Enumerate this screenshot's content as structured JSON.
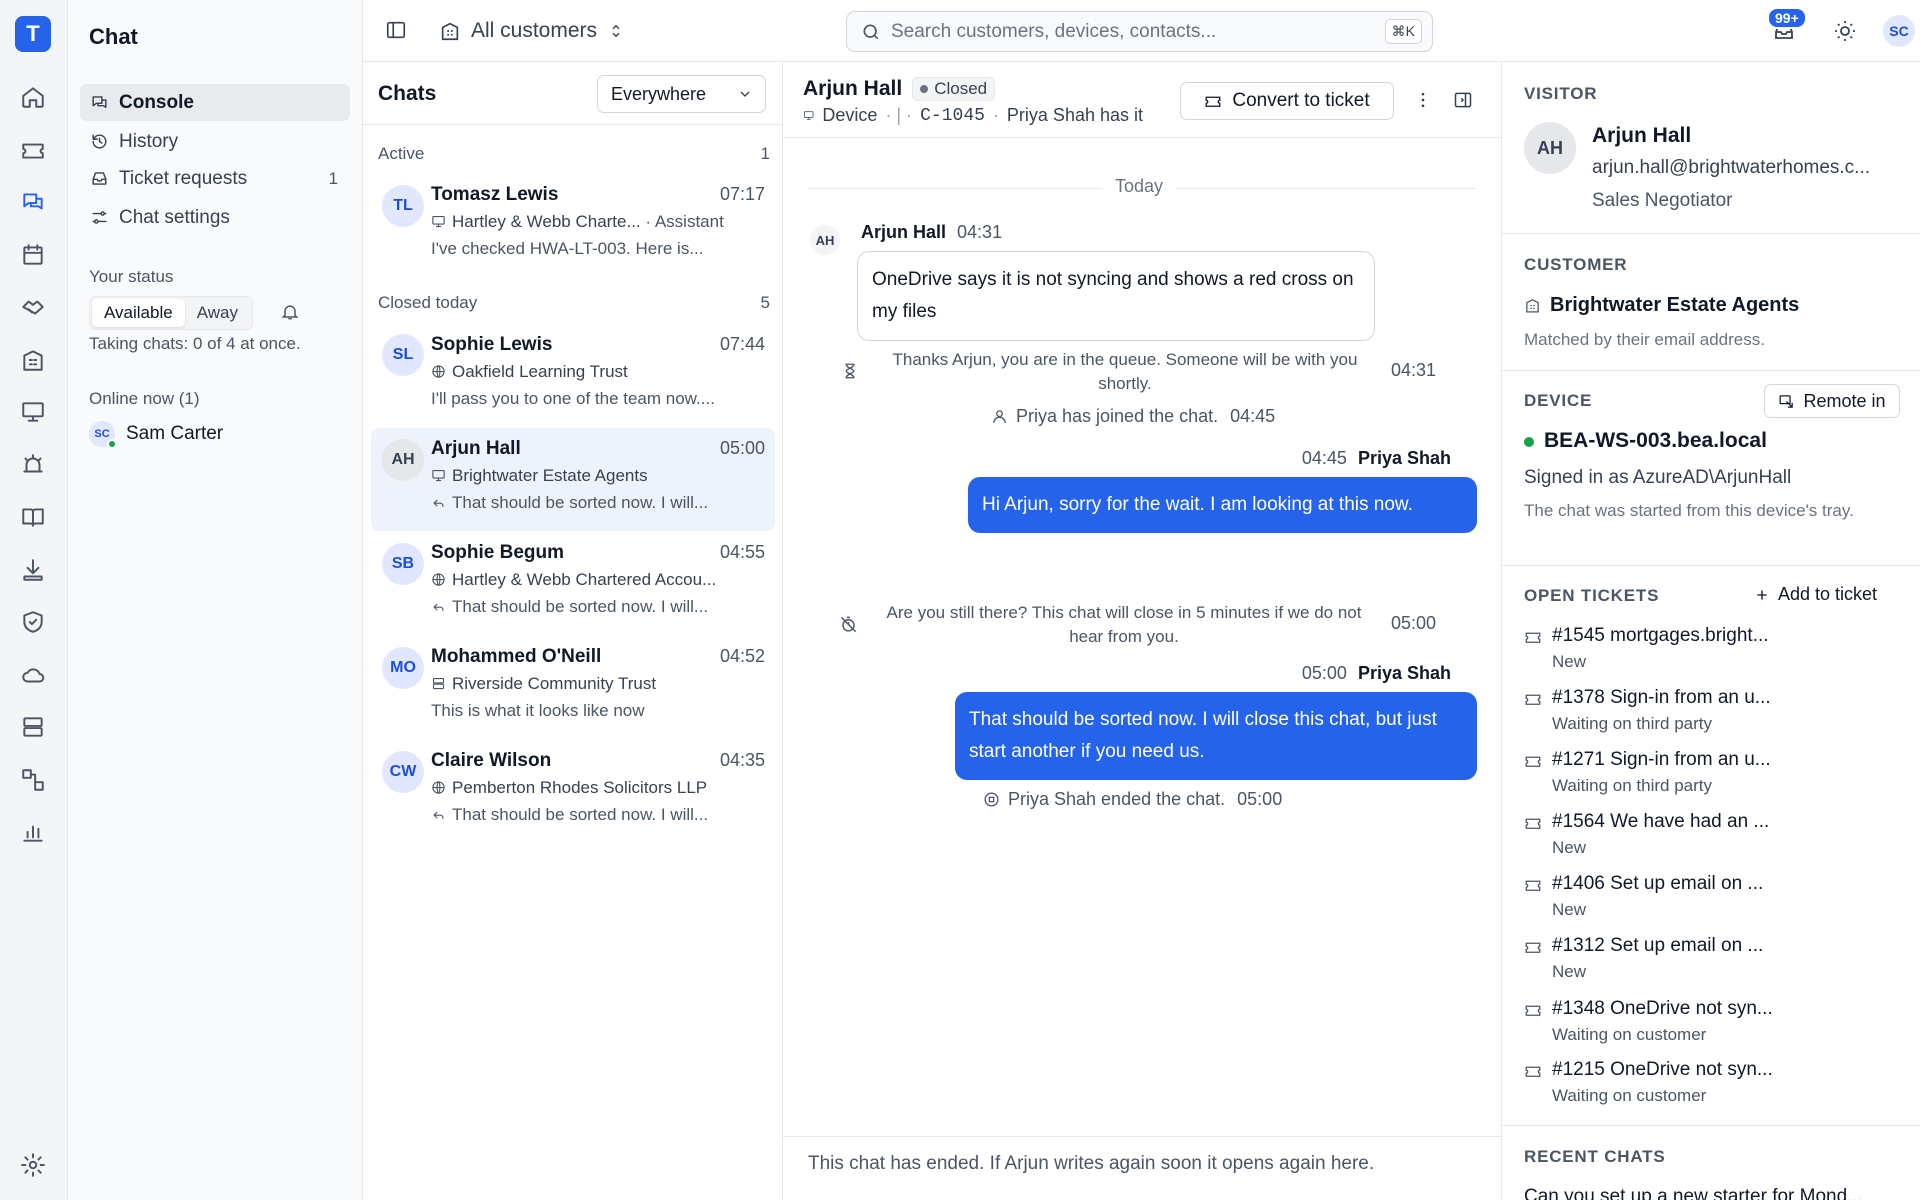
{
  "app": {
    "logo_letter": "T",
    "section_title": "Chat"
  },
  "rail": [
    "home-icon",
    "ticket-icon",
    "chat-icon",
    "calendar-icon",
    "handshake-icon",
    "building-icon",
    "monitor-icon",
    "alarm-icon",
    "book-icon",
    "download-icon",
    "shield-icon",
    "cloud-icon",
    "server-icon",
    "workflow-icon",
    "chart-icon"
  ],
  "nav": {
    "items": [
      {
        "label": "Console",
        "count": ""
      },
      {
        "label": "History",
        "count": ""
      },
      {
        "label": "Ticket requests",
        "count": "1"
      },
      {
        "label": "Chat settings",
        "count": ""
      }
    ],
    "your_status": "Your status",
    "status_available": "Available",
    "status_away": "Away",
    "taking": "Taking chats: 0 of 4 at once.",
    "online_now": "Online now (1)",
    "online_user_initials": "SC",
    "online_user_name": "Sam Carter"
  },
  "header": {
    "scope": "All customers",
    "search_placeholder": "Search customers, devices, contacts...",
    "shortcut": "⌘K",
    "notif_count": "99+",
    "user_initials": "SC"
  },
  "chats": {
    "title": "Chats",
    "filter": "Everywhere",
    "active_label": "Active",
    "active_count": "1",
    "closed_label": "Closed today",
    "closed_count": "5",
    "items": [
      {
        "initials": "TL",
        "name": "Tomasz Lewis",
        "time": "07:17",
        "sub": "Hartley & Webb Charte...",
        "sub2": "· Assistant",
        "msg": "I've checked HWA-LT-003. Here is..."
      },
      {
        "initials": "SL",
        "name": "Sophie Lewis",
        "time": "07:44",
        "sub": "Oakfield Learning Trust",
        "sub2": "",
        "msg": "I'll pass you to one of the team now...."
      },
      {
        "initials": "AH",
        "name": "Arjun Hall",
        "time": "05:00",
        "sub": "Brightwater Estate Agents",
        "sub2": "",
        "msg": "That should be sorted now. I will..."
      },
      {
        "initials": "SB",
        "name": "Sophie Begum",
        "time": "04:55",
        "sub": "Hartley & Webb Chartered Accou...",
        "sub2": "",
        "msg": "That should be sorted now. I will..."
      },
      {
        "initials": "MO",
        "name": "Mohammed O'Neill",
        "time": "04:52",
        "sub": "Riverside Community Trust",
        "sub2": "",
        "msg": "This is what it looks like now"
      },
      {
        "initials": "CW",
        "name": "Claire Wilson",
        "time": "04:35",
        "sub": "Pemberton Rhodes Solicitors LLP",
        "sub2": "",
        "msg": "That should be sorted now. I will..."
      }
    ]
  },
  "conversation": {
    "name": "Arjun Hall",
    "status": "Closed",
    "meta_device": "Device",
    "meta_ref": "C-1045",
    "meta_owner": "Priya Shah has it",
    "convert_label": "Convert to ticket",
    "day": "Today",
    "msg1_initials": "AH",
    "msg1_author": "Arjun Hall",
    "msg1_time": "04:31",
    "msg1_text": "OneDrive says it is not syncing and shows a red cross on my files",
    "queue_text": "Thanks Arjun, you are in the queue. Someone will be with you shortly.",
    "queue_time": "04:31",
    "joined_text": "Priya has joined the chat.",
    "joined_time": "04:45",
    "msg2_time": "04:45",
    "msg2_author": "Priya Shah",
    "msg2_text": "Hi Arjun, sorry for the wait. I am looking at this now.",
    "idle_text": "Are you still there? This chat will close in 5 minutes if we do not hear from you.",
    "idle_time": "05:00",
    "msg3_time": "05:00",
    "msg3_author": "Priya Shah",
    "msg3_text": "That should be sorted now. I will close this chat, but just start another if you need us.",
    "ended_text": "Priya Shah ended the chat.",
    "ended_time": "05:00",
    "footer": "This chat has ended. If Arjun writes again soon it opens again here."
  },
  "visitor": {
    "heading": "VISITOR",
    "initials": "AH",
    "name": "Arjun Hall",
    "email": "arjun.hall@brightwaterhomes.c...",
    "role": "Sales Negotiator"
  },
  "customer": {
    "heading": "CUSTOMER",
    "name": "Brightwater Estate Agents",
    "note": "Matched by their email address."
  },
  "device": {
    "heading": "DEVICE",
    "remote_label": "Remote in",
    "name": "BEA-WS-003.bea.local",
    "signed_in": "Signed in as AzureAD\\ArjunHall",
    "note": "The chat was started from this device's tray.",
    "status_color": "#16a34a"
  },
  "tickets": {
    "heading": "OPEN TICKETS",
    "add_label": "Add to ticket",
    "items": [
      {
        "title": "#1545 mortgages.bright...",
        "status": "New"
      },
      {
        "title": "#1378 Sign-in from an u...",
        "status": "Waiting on third party"
      },
      {
        "title": "#1271 Sign-in from an u...",
        "status": "Waiting on third party"
      },
      {
        "title": "#1564 We have had an ...",
        "status": "New"
      },
      {
        "title": "#1406 Set up email on ...",
        "status": "New"
      },
      {
        "title": "#1312 Set up email on ...",
        "status": "New"
      },
      {
        "title": "#1348 OneDrive not syn...",
        "status": "Waiting on customer"
      },
      {
        "title": "#1215 OneDrive not syn...",
        "status": "Waiting on customer"
      }
    ]
  },
  "recent": {
    "heading": "RECENT CHATS",
    "first": "Can you set up a new starter for Mond..."
  },
  "colors": {
    "accent": "#2563eb",
    "online": "#16a34a"
  }
}
